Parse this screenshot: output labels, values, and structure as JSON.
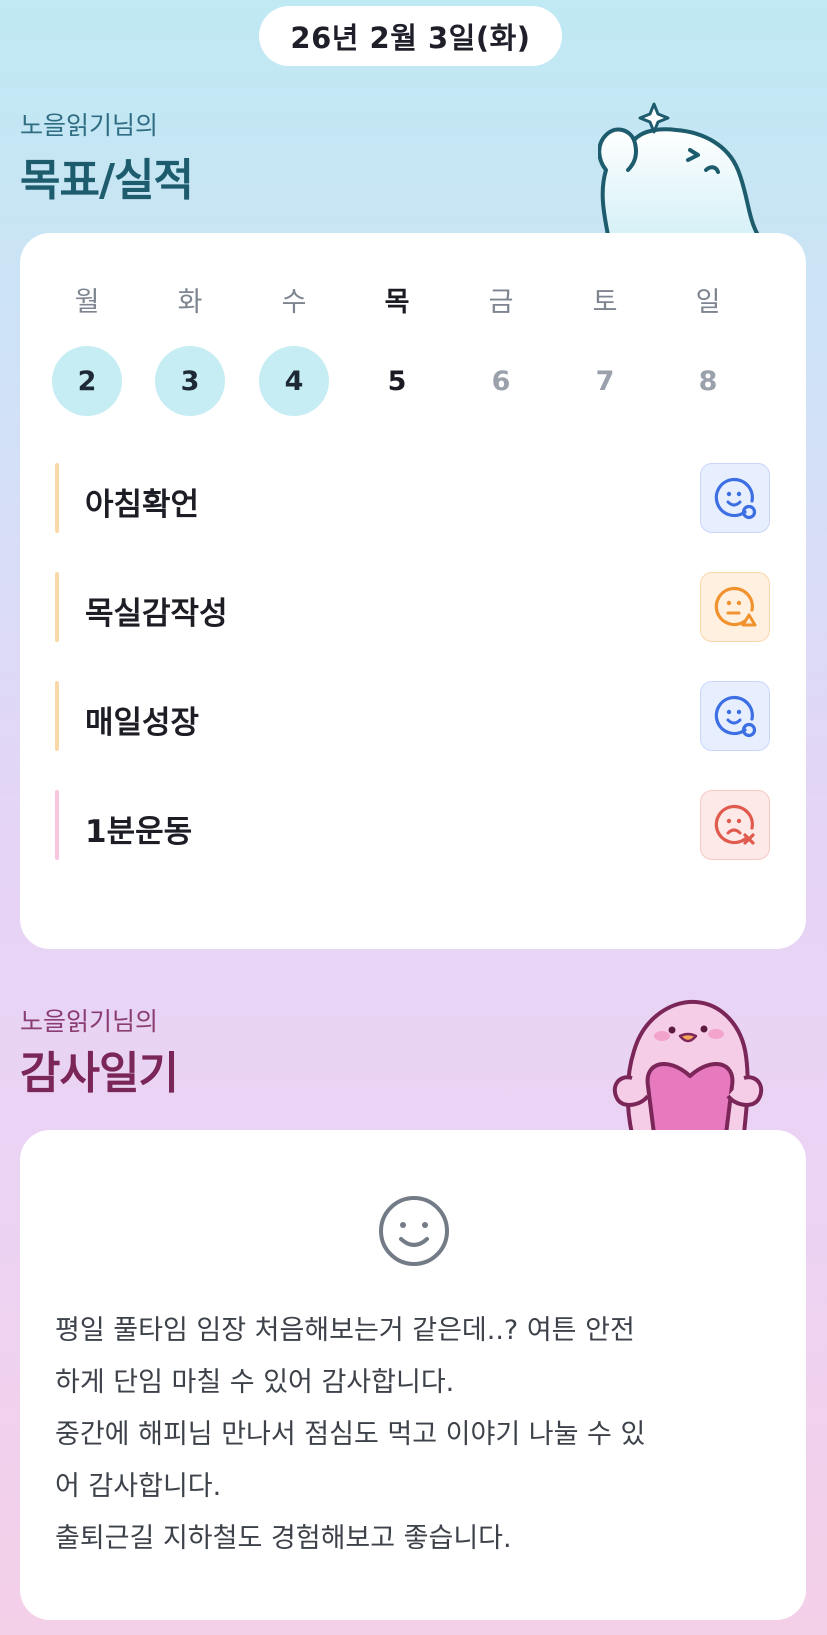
{
  "header": {
    "date": "26년 2월 3일(화)"
  },
  "goals_section": {
    "subtitle": "노을읽기님의",
    "title": "목표/실적",
    "week": [
      {
        "day": "월",
        "num": "2",
        "state": "done"
      },
      {
        "day": "화",
        "num": "3",
        "state": "done"
      },
      {
        "day": "수",
        "num": "4",
        "state": "done"
      },
      {
        "day": "목",
        "num": "5",
        "state": "today"
      },
      {
        "day": "금",
        "num": "6",
        "state": "future"
      },
      {
        "day": "토",
        "num": "7",
        "state": "future"
      },
      {
        "day": "일",
        "num": "8",
        "state": "future"
      }
    ],
    "goals": [
      {
        "label": "아침확언",
        "status": "circle",
        "bar_color": "#f9d9a8",
        "icon": "smile-circle-icon"
      },
      {
        "label": "목실감작성",
        "status": "triangle",
        "bar_color": "#f9d9a8",
        "icon": "face-triangle-icon"
      },
      {
        "label": "매일성장",
        "status": "circle",
        "bar_color": "#f9d9a8",
        "icon": "smile-circle-icon"
      },
      {
        "label": "1분운동",
        "status": "x",
        "bar_color": "#f7c6de",
        "icon": "sad-x-icon"
      }
    ]
  },
  "gratitude_section": {
    "subtitle": "노을읽기님의",
    "title": "감사일기",
    "mood_icon": "smile-face-icon",
    "text": "평일 풀타임 임장 처음해보는거 같은데..? 여튼 안전\n하게 단임 마칠 수 있어 감사합니다.\n중간에 해피님 만나서 점심도 먹고 이야기 나눌 수 있\n어 감사합니다.\n출퇴근길 지하철도 경험해보고 좋습니다."
  },
  "colors": {
    "blue_status": "#3b6fe3",
    "orange_status": "#f0922d",
    "red_status": "#e05a4e",
    "title_teal": "#1d5c6d",
    "title_plum": "#7b2658"
  }
}
